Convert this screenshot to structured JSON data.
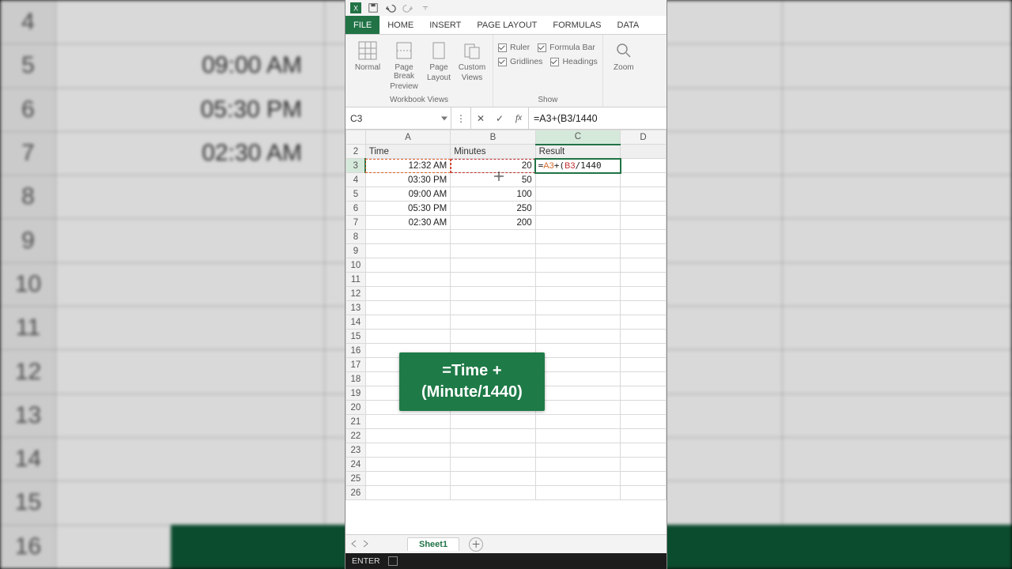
{
  "background_rows": [
    {
      "n": "4",
      "v": ""
    },
    {
      "n": "5",
      "v": "09:00 AM"
    },
    {
      "n": "6",
      "v": "05:30 PM"
    },
    {
      "n": "7",
      "v": "02:30 AM"
    },
    {
      "n": "8",
      "v": ""
    },
    {
      "n": "9",
      "v": ""
    },
    {
      "n": "10",
      "v": ""
    },
    {
      "n": "11",
      "v": ""
    },
    {
      "n": "12",
      "v": ""
    },
    {
      "n": "13",
      "v": ""
    },
    {
      "n": "14",
      "v": ""
    },
    {
      "n": "15",
      "v": ""
    },
    {
      "n": "16",
      "v": ""
    }
  ],
  "qat": {
    "undo_state": "enabled",
    "redo_state": "disabled"
  },
  "tabs": {
    "file": "FILE",
    "home": "HOME",
    "insert": "INSERT",
    "page_layout": "PAGE LAYOUT",
    "formulas": "FORMULAS",
    "data": "DATA"
  },
  "ribbon": {
    "views_group_label": "Workbook Views",
    "show_group_label": "Show",
    "btn_normal": "Normal",
    "btn_pagebreak_l1": "Page Break",
    "btn_pagebreak_l2": "Preview",
    "btn_pagelayout_l1": "Page",
    "btn_pagelayout_l2": "Layout",
    "btn_custom_l1": "Custom",
    "btn_custom_l2": "Views",
    "chk_ruler": "Ruler",
    "chk_formula_bar": "Formula Bar",
    "chk_gridlines": "Gridlines",
    "chk_headings": "Headings",
    "btn_zoom": "Zoom"
  },
  "formula_bar": {
    "name_box": "C3",
    "formula": "=A3+(B3/1440"
  },
  "columns": [
    "A",
    "B",
    "C",
    "D"
  ],
  "header_row_labels": {
    "A": "Time",
    "B": "Minutes",
    "C": "Result"
  },
  "data_rows": [
    {
      "n": 3,
      "A": "12:32 AM",
      "B": "20",
      "C_formula": "=A3+(B3/1440",
      "C_tokA": "A3",
      "C_tokB": "B3",
      "C_rest": "/1440"
    },
    {
      "n": 4,
      "A": "03:30 PM",
      "B": "50"
    },
    {
      "n": 5,
      "A": "09:00 AM",
      "B": "100"
    },
    {
      "n": 6,
      "A": "05:30 PM",
      "B": "250"
    },
    {
      "n": 7,
      "A": "02:30 AM",
      "B": "200"
    }
  ],
  "empty_rows": [
    8,
    9,
    10,
    11,
    12,
    13,
    14,
    15,
    16,
    17,
    18,
    19,
    20,
    21,
    22,
    23,
    24,
    25,
    26
  ],
  "tooltip_l1": "=Time +",
  "tooltip_l2": "(Minute/1440)",
  "sheet_tab": "Sheet1",
  "status_mode": "ENTER",
  "chart_data": {
    "type": "table",
    "title": "Add minutes to a time in Excel",
    "columns": [
      "Time",
      "Minutes",
      "Result"
    ],
    "rows": [
      {
        "Time": "12:32 AM",
        "Minutes": 20,
        "ResultFormula": "=A3+(B3/1440)"
      },
      {
        "Time": "03:30 PM",
        "Minutes": 50
      },
      {
        "Time": "09:00 AM",
        "Minutes": 100
      },
      {
        "Time": "05:30 PM",
        "Minutes": 250
      },
      {
        "Time": "02:30 AM",
        "Minutes": 200
      }
    ],
    "formula_pattern": "=Time + (Minute/1440)"
  }
}
